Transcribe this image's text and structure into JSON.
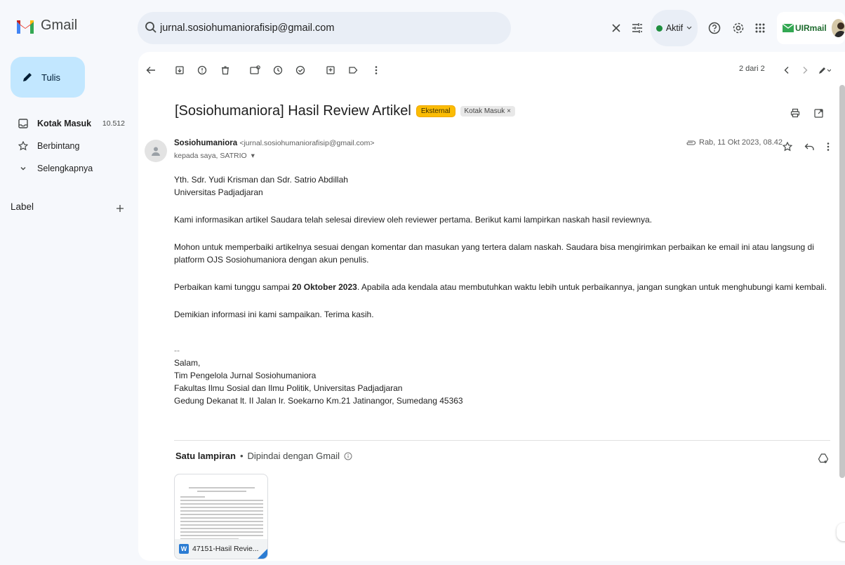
{
  "app": {
    "brand": "Gmail"
  },
  "search": {
    "value": "jurnal.sosiohumaniorafisip@gmail.com"
  },
  "header": {
    "status": "Aktif",
    "account_label": "UIRmail"
  },
  "sidebar": {
    "compose_label": "Tulis",
    "items": [
      {
        "label": "Kotak Masuk",
        "count": "10.512",
        "icon": "inbox-icon"
      },
      {
        "label": "Berbintang",
        "count": "",
        "icon": "star-icon"
      },
      {
        "label": "Selengkapnya",
        "count": "",
        "icon": "chevron-down-icon"
      }
    ],
    "labels_heading": "Label"
  },
  "toolbar": {
    "pager": "2 dari 2"
  },
  "email": {
    "subject": "[Sosiohumaniora] Hasil Review Artikel",
    "badges": {
      "external": "Eksternal",
      "inbox": "Kotak Masuk ×"
    },
    "sender_name": "Sosiohumaniora",
    "sender_email": "<jurnal.sosiohumaniorafisip@gmail.com>",
    "to_line": "kepada saya, SATRIO",
    "date": "Rab, 11 Okt 2023, 08.42",
    "body": {
      "greeting1": "Yth. Sdr. Yudi Krisman dan Sdr. Satrio Abdillah",
      "greeting2": "Universitas Padjadjaran",
      "p1": "Kami informasikan artikel Saudara telah selesai direview oleh reviewer pertama. Berikut kami lampirkan naskah hasil reviewnya.",
      "p2": "Mohon untuk memperbaiki artikelnya sesuai dengan komentar dan masukan yang tertera dalam naskah. Saudara bisa mengirimkan perbaikan ke email ini atau langsung di platform OJS Sosiohumaniora dengan akun penulis.",
      "p3_pre": "Perbaikan kami tunggu sampai ",
      "p3_bold": "20 Oktober 2023",
      "p3_post": ". Apabila ada kendala atau membutuhkan waktu lebih untuk perbaikannya, jangan sungkan untuk menghubungi kami kembali.",
      "p4": "Demikian informasi ini kami sampaikan. Terima kasih.",
      "sig_dash": "--",
      "sig1": "Salam,",
      "sig2": "Tim Pengelola Jurnal Sosiohumaniora",
      "sig3": "Fakultas Ilmu Sosial dan Ilmu Politik, Universitas Padjadjaran",
      "sig4": "Gedung Dekanat lt. II Jalan Ir. Soekarno Km.21 Jatinangor, Sumedang 45363"
    },
    "attachments": {
      "heading": "Satu lampiran",
      "separator": "•",
      "scanned": "Dipindai dengan Gmail",
      "file_name": "47151-Hasil Revie...",
      "file_type_letter": "W"
    }
  },
  "colors": {
    "accent_compose": "#c2e7ff",
    "badge_external": "#fbbc04",
    "status_active": "#1e8e3e",
    "word_blue": "#2b7cd3"
  }
}
